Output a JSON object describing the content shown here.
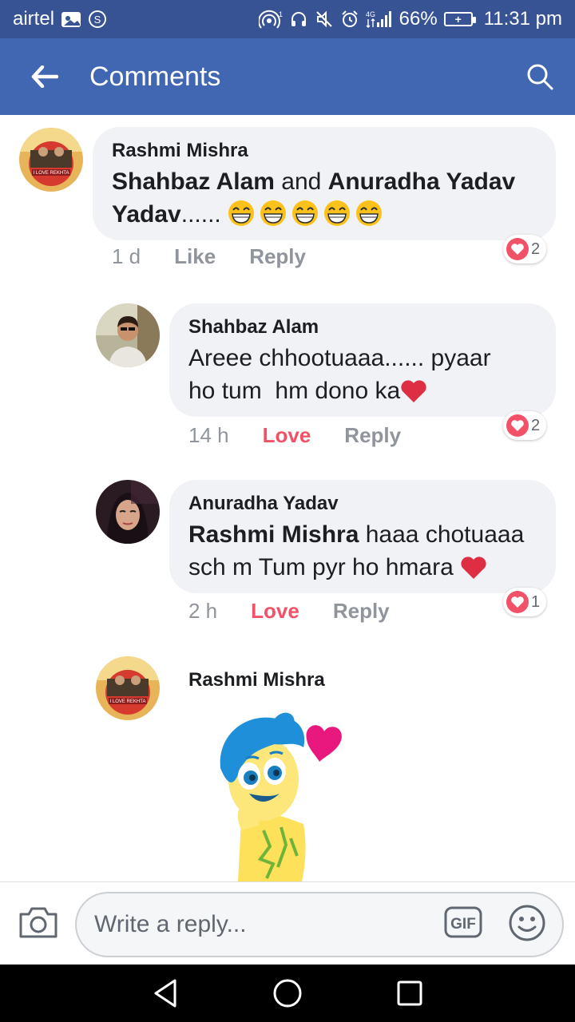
{
  "status_bar": {
    "carrier": "airtel",
    "carrier_badge": "S",
    "network_label": "4G",
    "battery": "66%",
    "time": "11:31 pm"
  },
  "header": {
    "title": "Comments",
    "back_icon": "arrow-left-icon",
    "search_icon": "search-icon",
    "bg_color": "#4267b2"
  },
  "comments": [
    {
      "author": "Rashmi Mishra",
      "mentions": [
        "Shahbaz Alam",
        "Anuradha Yadav"
      ],
      "connector": " and ",
      "tail": "...... ",
      "emojis": [
        "😁",
        "😁",
        "😁",
        "😁",
        "😁"
      ],
      "time": "1 d",
      "like_label": "Like",
      "reply_label": "Reply",
      "reaction_count": "2",
      "reaction_icon": "heart-icon"
    },
    {
      "author": "Shahbaz Alam",
      "text_line1": "Areee chhootuaaa...... pyaar",
      "text_line2": "ho tum  hm dono ka",
      "emoji": "❤️",
      "time": "14 h",
      "like_label": "Love",
      "reply_label": "Reply",
      "reaction_count": "2",
      "reaction_icon": "heart-icon"
    },
    {
      "author": "Anuradha Yadav",
      "mention": "Rashmi Mishra",
      "text_rest": " haaa chotuaaa",
      "text_line2": "sch m Tum pyr ho hmara ",
      "emoji": "❤️",
      "time": "2 h",
      "like_label": "Love",
      "reply_label": "Reply",
      "reaction_count": "1",
      "reaction_icon": "heart-icon"
    },
    {
      "author": "Rashmi Mishra",
      "sticker": "joy-heart-sticker"
    }
  ],
  "avatar_badge_text": "I LOVE REKHTA",
  "reply_bar": {
    "placeholder": "Write a reply...",
    "gif_label": "GIF",
    "camera_icon": "camera-icon",
    "emoji_icon": "smiley-icon"
  },
  "colors": {
    "love": "#f25268",
    "muted": "#90949c",
    "bubble": "#f0f2f5"
  }
}
